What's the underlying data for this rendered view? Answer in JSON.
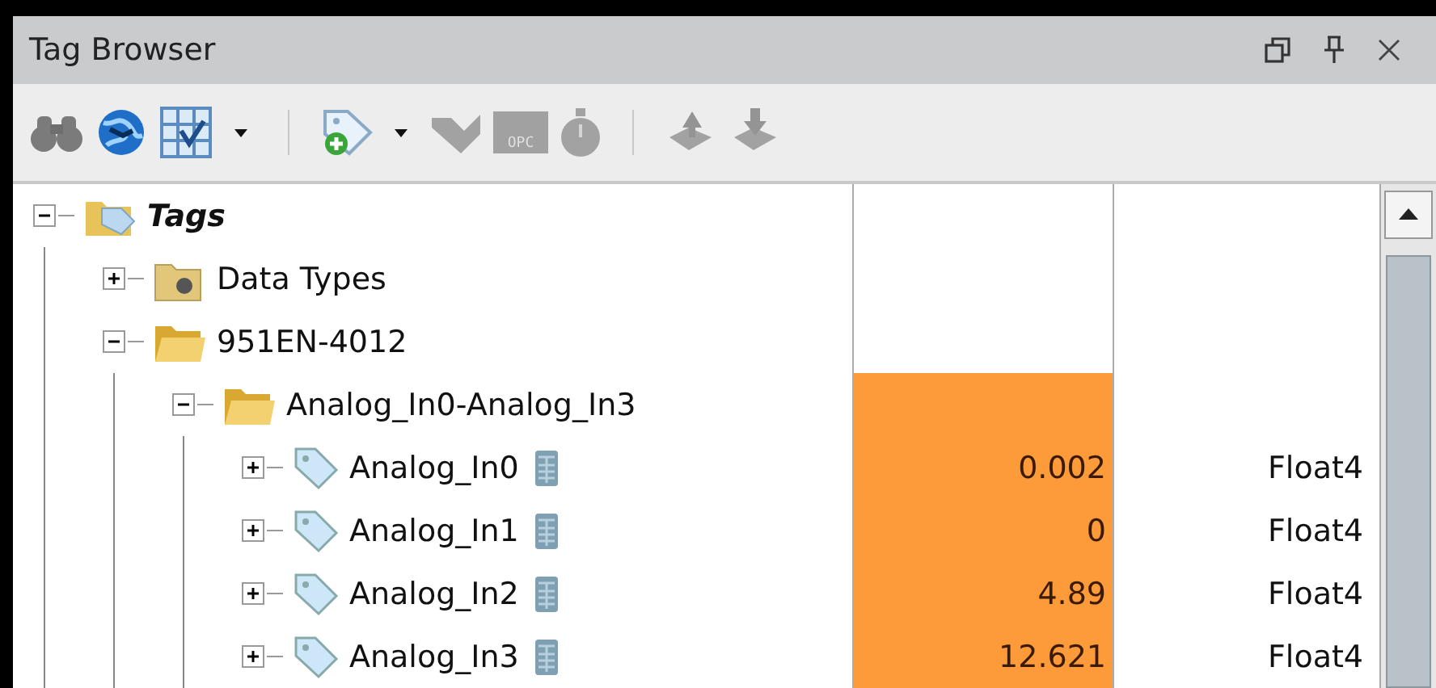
{
  "window": {
    "title": "Tag Browser",
    "controls": [
      {
        "kind": "restore"
      },
      {
        "kind": "pin"
      },
      {
        "kind": "close"
      }
    ]
  },
  "toolbar": [
    {
      "kind": "binoculars",
      "disabled": true
    },
    {
      "kind": "globe",
      "disabled": false
    },
    {
      "kind": "grid",
      "disabled": false
    },
    {
      "kind": "caret",
      "disabled": false
    },
    {
      "kind": "separator"
    },
    {
      "kind": "tag-add",
      "disabled": false
    },
    {
      "kind": "caret",
      "disabled": false
    },
    {
      "kind": "check",
      "disabled": true
    },
    {
      "kind": "opc",
      "label": "OPC",
      "disabled": true
    },
    {
      "kind": "stopwatch",
      "disabled": true
    },
    {
      "kind": "separator"
    },
    {
      "kind": "import",
      "disabled": true
    },
    {
      "kind": "export",
      "disabled": true
    }
  ],
  "tree": [
    {
      "kind": "root",
      "label": "Tags",
      "expanded": true,
      "highlighted": false,
      "children": [
        {
          "kind": "datatypes",
          "label": "Data Types",
          "expanded": false,
          "highlighted": false
        },
        {
          "kind": "folder",
          "label": "951EN-4012",
          "expanded": true,
          "highlighted": false,
          "children": [
            {
              "kind": "folder",
              "label": "Analog_In0-Analog_In3",
              "expanded": true,
              "highlighted": true,
              "children": [
                {
                  "kind": "tag",
                  "label": "Analog_In0",
                  "expanded": false,
                  "highlighted": true,
                  "value": "0.002",
                  "type": "Float4"
                },
                {
                  "kind": "tag",
                  "label": "Analog_In1",
                  "expanded": false,
                  "highlighted": true,
                  "value": "0",
                  "type": "Float4"
                },
                {
                  "kind": "tag",
                  "label": "Analog_In2",
                  "expanded": false,
                  "highlighted": true,
                  "value": "4.89",
                  "type": "Float4"
                },
                {
                  "kind": "tag",
                  "label": "Analog_In3",
                  "expanded": false,
                  "highlighted": true,
                  "value": "12.621",
                  "type": "Float4"
                }
              ]
            }
          ]
        }
      ]
    }
  ]
}
